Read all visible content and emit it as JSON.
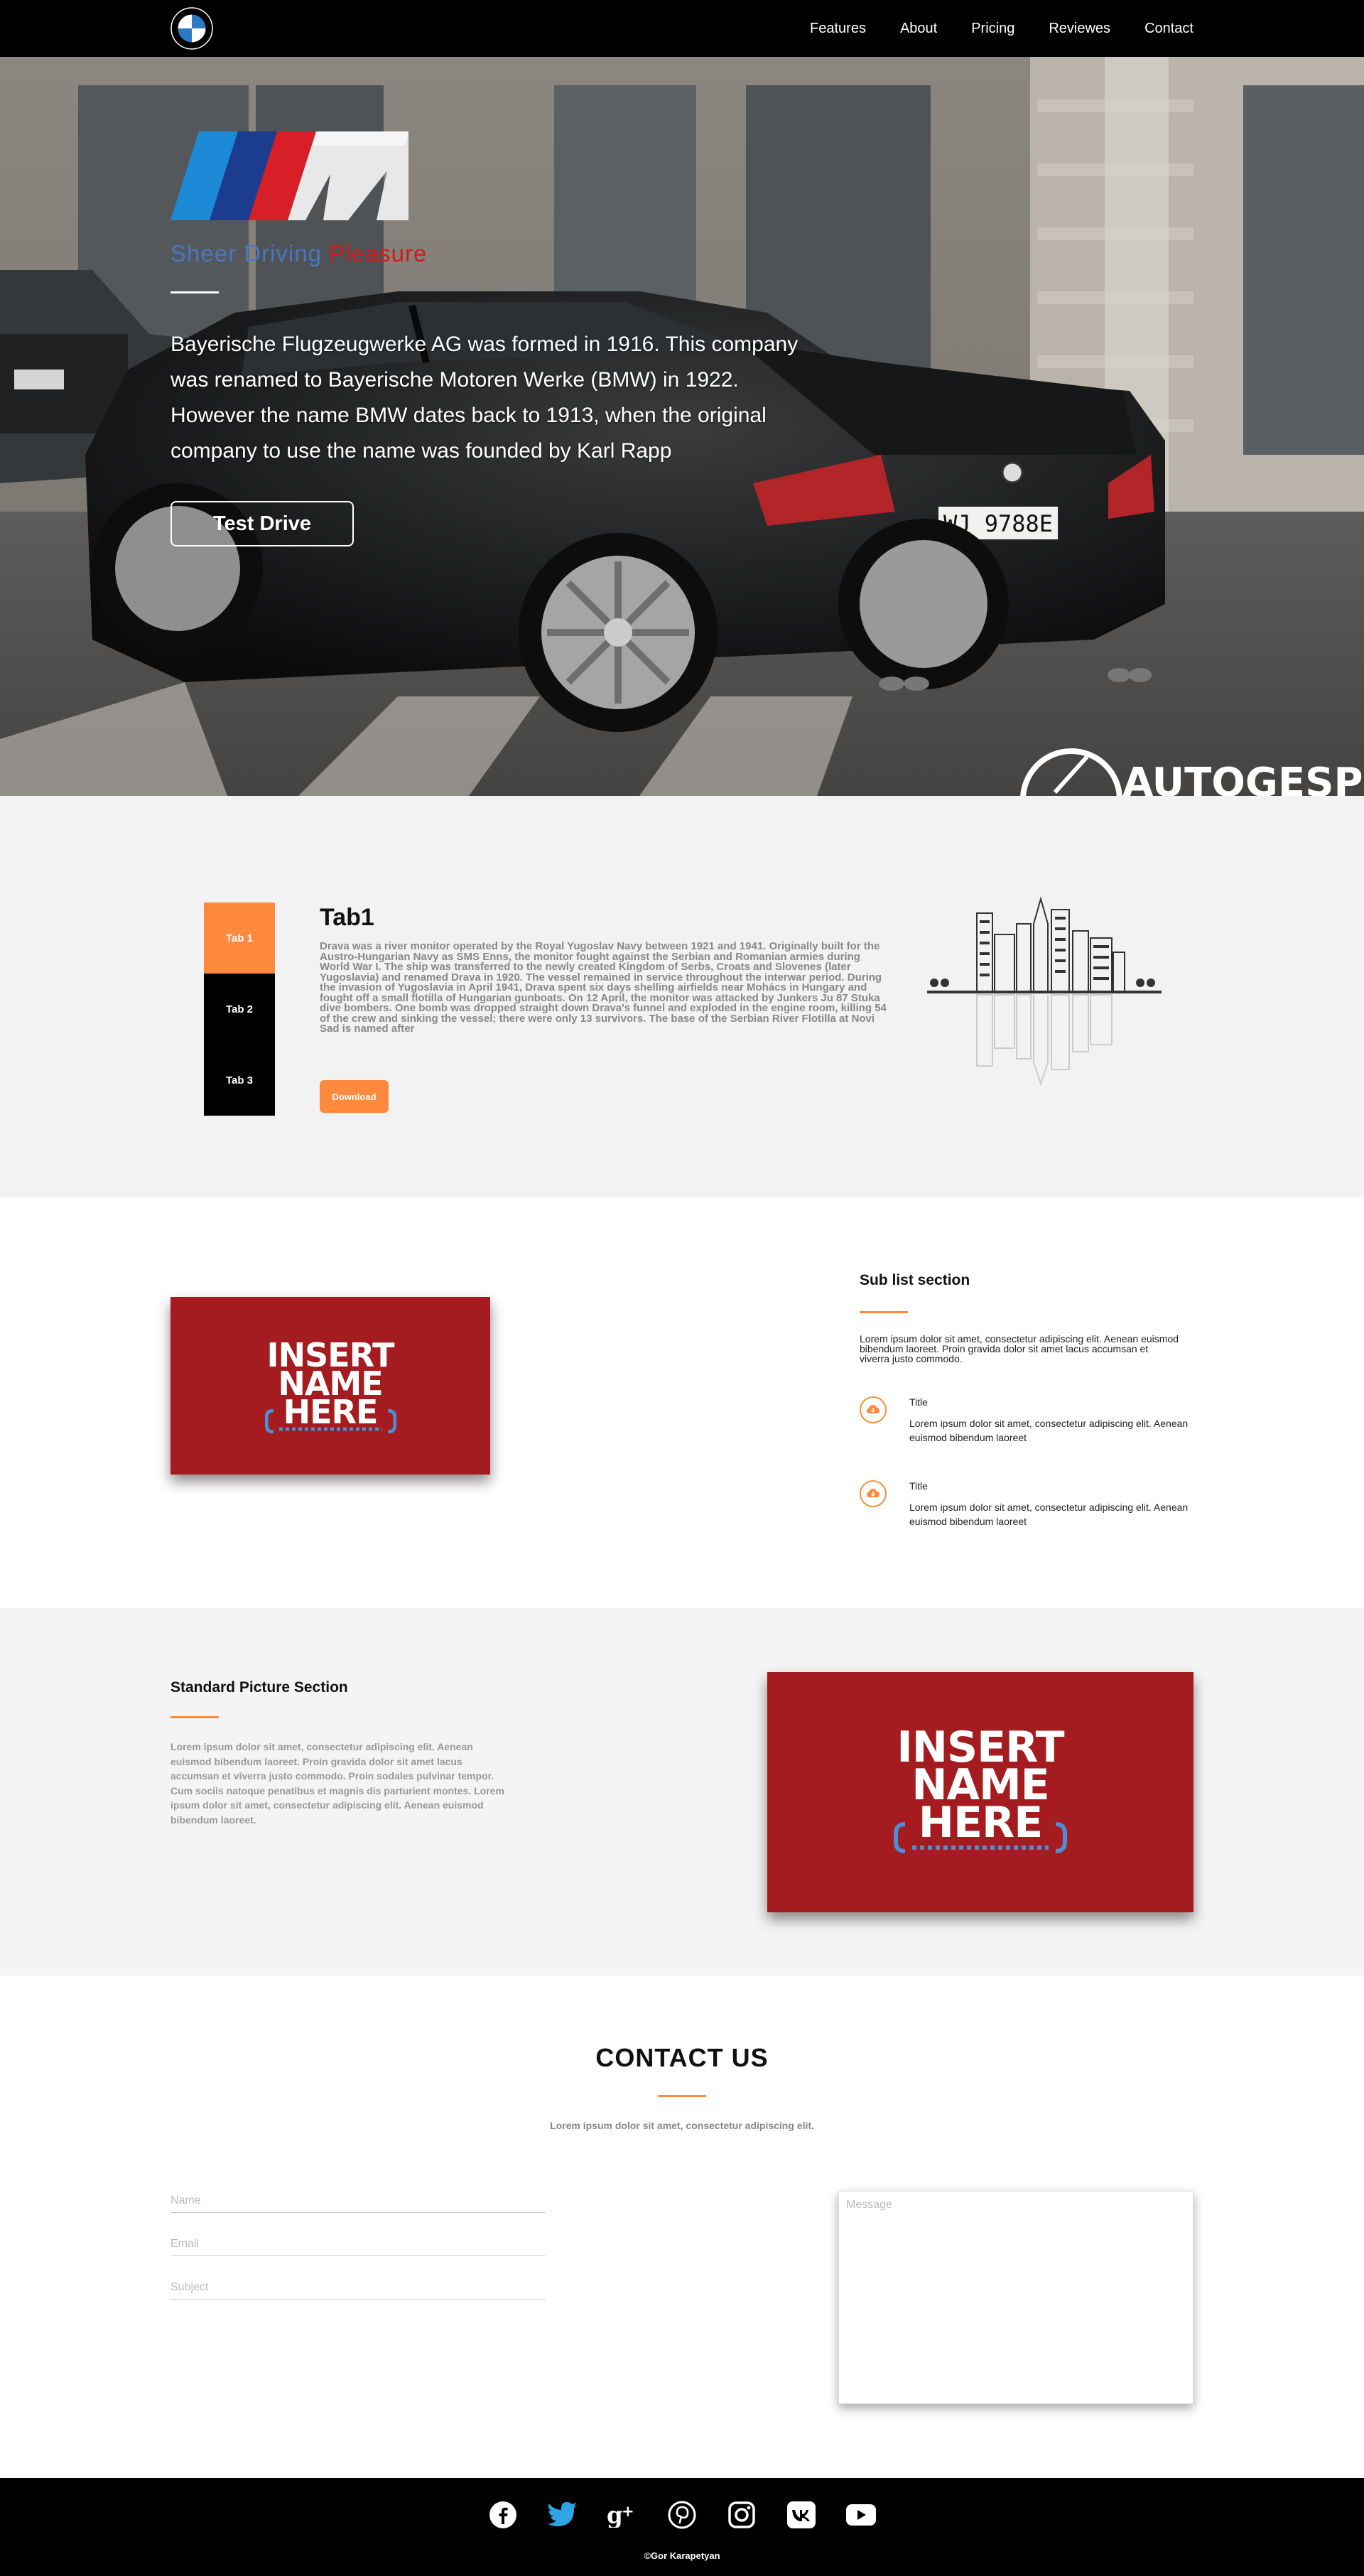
{
  "nav": {
    "logo_icon": "bmw-roundel-icon",
    "links": [
      "Features",
      "About",
      "Pricing",
      "Reviewes",
      "Contact"
    ]
  },
  "hero": {
    "logo_icon": "bmw-m-logo",
    "tagline_part1": "Sheer Driving",
    "tagline_part2": " Pleasure",
    "text": "Bayerische Flugzeugwerke AG was formed in 1916. This company was renamed to Bayerische Motoren Werke (BMW) in 1922. However the name BMW dates back to 1913, when the original company to use the name was founded by Karl Rapp",
    "button": "Test Drive",
    "watermark": "AUTOGESPOT",
    "plate": "WJ 9788E"
  },
  "tabs": {
    "items": [
      "Tab 1",
      "Tab 2",
      "Tab 3"
    ],
    "active_index": 0,
    "title": "Tab1",
    "body": "Drava was a river monitor operated by the Royal Yugoslav Navy between 1921 and 1941. Originally built for the Austro-Hungarian Navy as SMS Enns, the monitor fought against the Serbian and Romanian armies during World War I. The ship was transferred to the newly created Kingdom of Serbs, Croats and Slovenes (later Yugoslavia) and renamed Drava in 1920. The vessel remained in service throughout the interwar period. During the invasion of Yugoslavia in April 1941, Drava spent six days shelling airfields near Mohács in Hungary and fought off a small flotilla of Hungarian gunboats. On 12 April, the monitor was attacked by Junkers Ju 87 Stuka dive bombers. One bomb was dropped straight down Drava's funnel and exploded in the engine room, killing 54 of the crew and sinking the vessel; there were only 13 survivors. The base of the Serbian River Flotilla at Novi Sad is named after",
    "download": "Download",
    "illustration_icon": "city-skyline-icon"
  },
  "placeholder": {
    "line1": "INSERT",
    "line2": "NAME",
    "line3": "HERE"
  },
  "sublist": {
    "title": "Sub list section",
    "lead": "Lorem ipsum dolor sit amet, consectetur adipiscing elit. Aenean euismod bibendum laoreet. Proin gravida dolor sit amet lacus accumsan et viverra justo commodo.",
    "items": [
      {
        "title": "Title",
        "text": "Lorem ipsum dolor sit amet, consectetur adipiscing elit. Aenean euismod bibendum laoreet"
      },
      {
        "title": "Title",
        "text": "Lorem ipsum dolor sit amet, consectetur adipiscing elit. Aenean euismod bibendum laoreet"
      }
    ],
    "item_icon": "cloud-download-icon"
  },
  "standard": {
    "title": "Standard Picture Section",
    "text": "Lorem ipsum dolor sit amet, consectetur adipiscing elit. Aenean euismod bibendum laoreet. Proin gravida dolor sit amet lacus accumsan et viverra justo commodo. Proin sodales pulvinar tempor. Cum sociis natoque penatibus et magnis dis parturient montes. Lorem ipsum dolor sit amet, consectetur adipiscing elit. Aenean euismod bibendum laoreet."
  },
  "contact": {
    "title": "CONTACT US",
    "subtitle": "Lorem ipsum dolor sit amet, consectetur adipiscing elit.",
    "name_placeholder": "Name",
    "email_placeholder": "Email",
    "subject_placeholder": "Subject",
    "message_placeholder": "Message"
  },
  "footer": {
    "socials": [
      "facebook-icon",
      "twitter-icon",
      "google-plus-icon",
      "pinterest-icon",
      "instagram-icon",
      "vk-icon",
      "youtube-icon"
    ],
    "copyright": "©Gor Karapetyan"
  },
  "colors": {
    "accent": "#ff8a3d",
    "placeholder_red": "#a41c1f",
    "nav_bg": "#000000",
    "section_gray": "#f2f2f2"
  }
}
